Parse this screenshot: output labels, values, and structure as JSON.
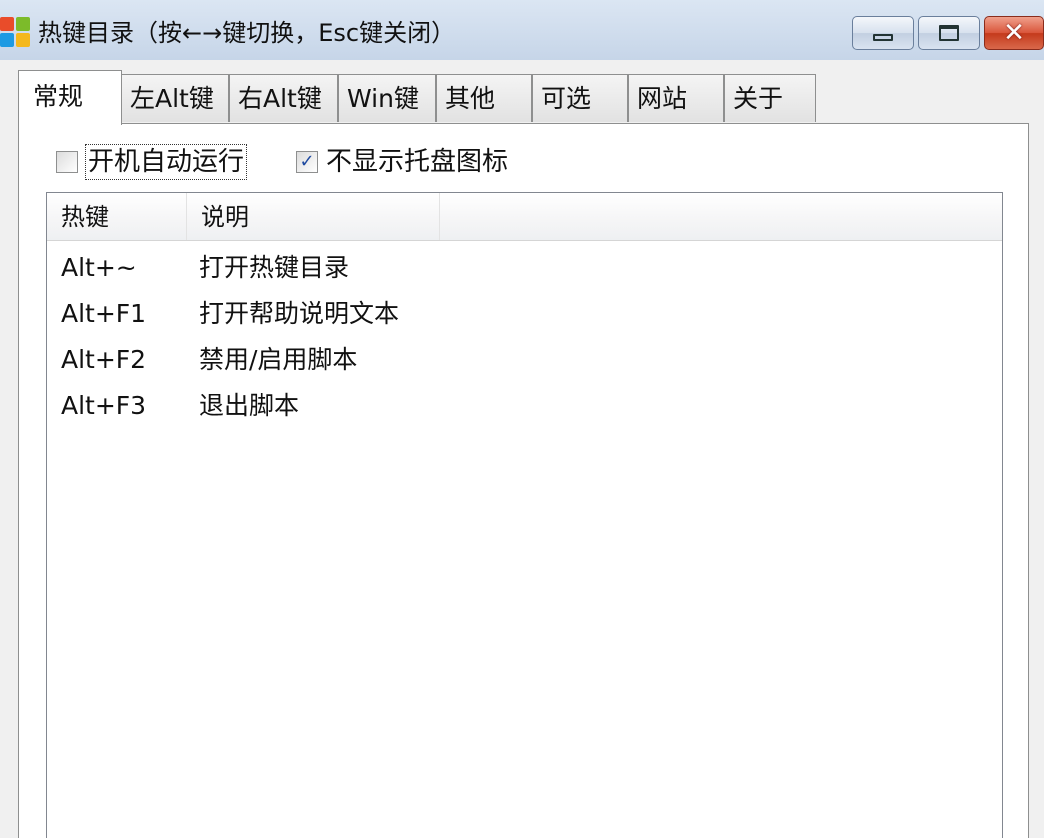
{
  "window": {
    "title": "热键目录（按←→键切换，Esc键关闭）",
    "icon": "windows-flag-icon"
  },
  "tabs": [
    {
      "label": "常规",
      "active": true
    },
    {
      "label": "左Alt键",
      "active": false
    },
    {
      "label": "右Alt键",
      "active": false
    },
    {
      "label": "Win键",
      "active": false
    },
    {
      "label": "其他",
      "active": false
    },
    {
      "label": "可选",
      "active": false
    },
    {
      "label": "网站",
      "active": false
    },
    {
      "label": "关于",
      "active": false
    }
  ],
  "options": {
    "autostart": {
      "label": "开机自动运行",
      "checked": false
    },
    "hide_tray": {
      "label": "不显示托盘图标",
      "checked": true
    }
  },
  "list": {
    "columns": [
      "热键",
      "说明"
    ],
    "rows": [
      {
        "key": "Alt+~",
        "desc": "打开热键目录"
      },
      {
        "key": "Alt+F1",
        "desc": "打开帮助说明文本"
      },
      {
        "key": "Alt+F2",
        "desc": "禁用/启用脚本"
      },
      {
        "key": "Alt+F3",
        "desc": "退出脚本"
      }
    ]
  },
  "colors": {
    "titlebar": "#c6d5e8",
    "close_button": "#c43a1c",
    "checkmark": "#1f4aa0"
  }
}
